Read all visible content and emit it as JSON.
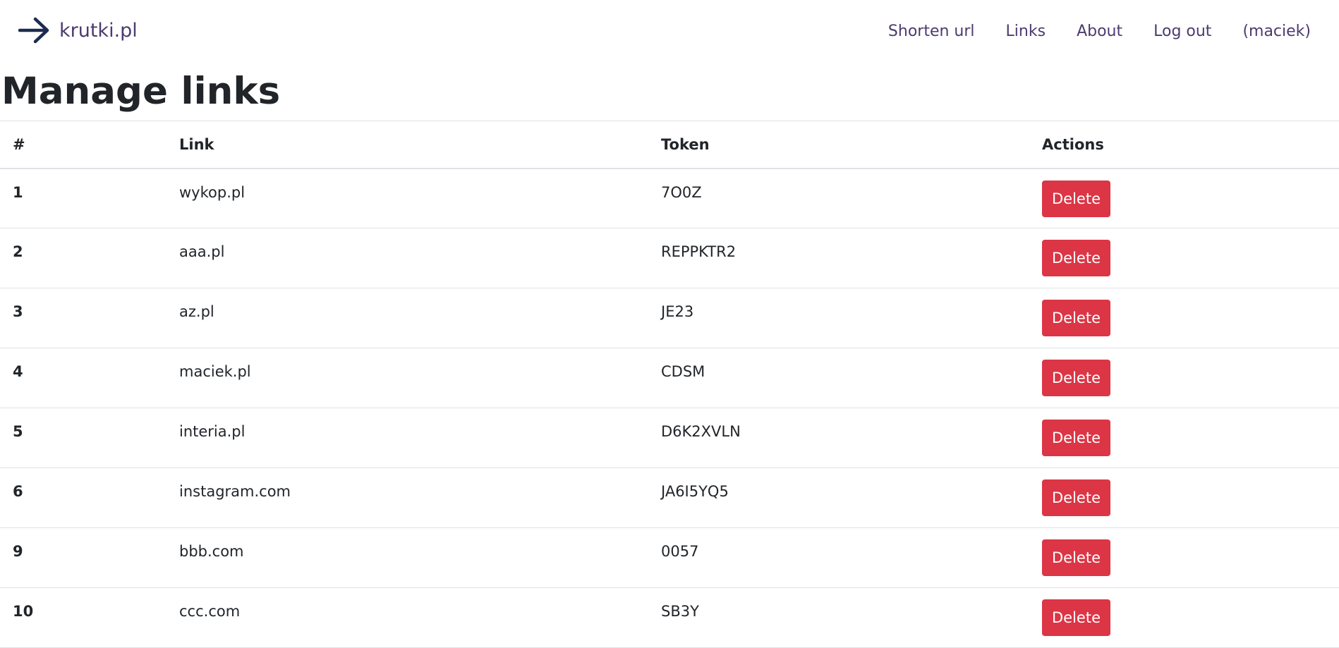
{
  "brand": {
    "name": "krutki.pl",
    "icon": "arrow-right-icon",
    "color": "#1c2b4f"
  },
  "nav": {
    "items": [
      "Shorten url",
      "Links",
      "About",
      "Log out",
      "(maciek)"
    ]
  },
  "page": {
    "title": "Manage links"
  },
  "table": {
    "headers": [
      "#",
      "Link",
      "Token",
      "Actions"
    ],
    "rows": [
      {
        "id": "1",
        "link": "wykop.pl",
        "token": "7O0Z",
        "action": "Delete"
      },
      {
        "id": "2",
        "link": "aaa.pl",
        "token": "REPPKTR2",
        "action": "Delete"
      },
      {
        "id": "3",
        "link": "az.pl",
        "token": "JE23",
        "action": "Delete"
      },
      {
        "id": "4",
        "link": "maciek.pl",
        "token": "CDSM",
        "action": "Delete"
      },
      {
        "id": "5",
        "link": "interia.pl",
        "token": "D6K2XVLN",
        "action": "Delete"
      },
      {
        "id": "6",
        "link": "instagram.com",
        "token": "JA6I5YQ5",
        "action": "Delete"
      },
      {
        "id": "9",
        "link": "bbb.com",
        "token": "0057",
        "action": "Delete"
      },
      {
        "id": "10",
        "link": "ccc.com",
        "token": "SB3Y",
        "action": "Delete"
      }
    ]
  },
  "colors": {
    "accent": "#4b3b6f",
    "danger": "#dc3545",
    "text": "#212529",
    "border": "#dee2e6"
  }
}
